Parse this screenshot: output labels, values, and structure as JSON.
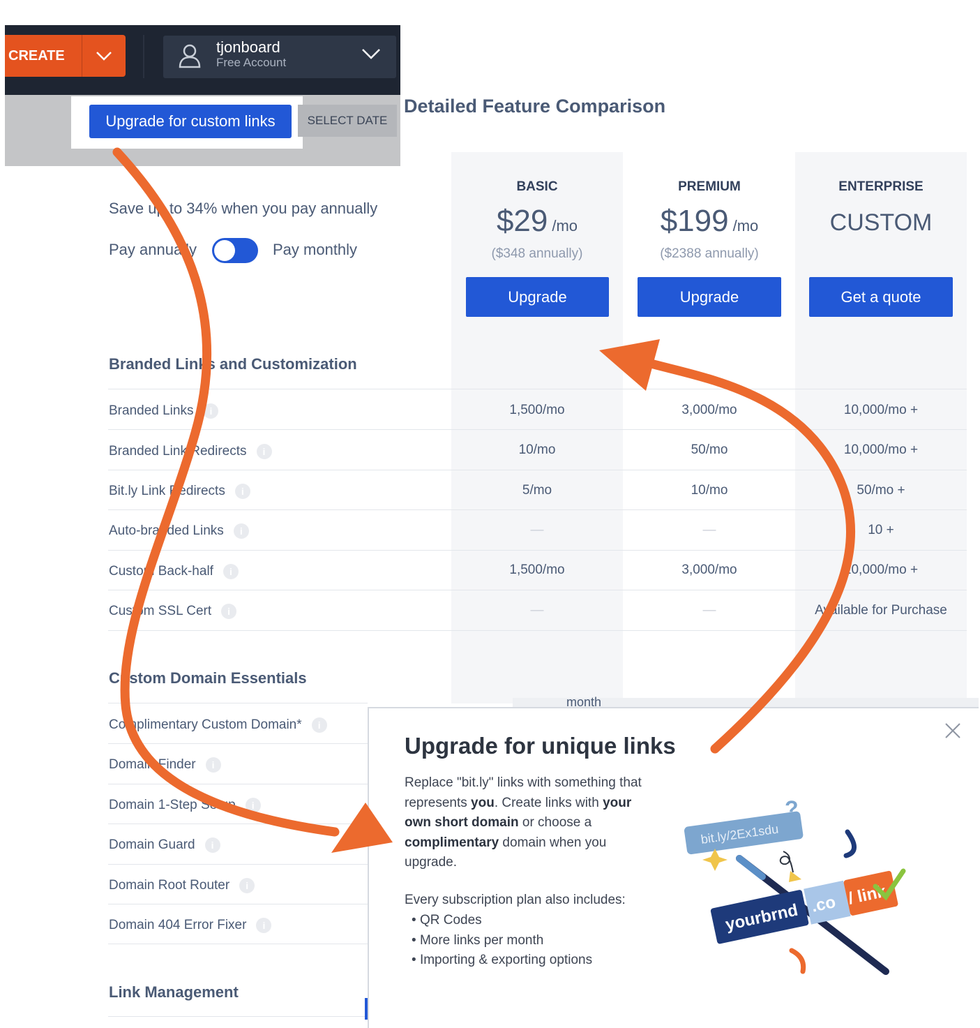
{
  "topbar": {
    "create_label": "CREATE",
    "username": "tjonboard",
    "account_type": "Free Account",
    "upgrade_custom_label": "Upgrade for custom links",
    "select_date_label": "SELECT DATE"
  },
  "comparison": {
    "title": "Detailed Feature Comparison",
    "save_text": "Save up to 34% when you pay annually",
    "pay_annually": "Pay annually",
    "pay_monthly": "Pay monthly",
    "plans": [
      {
        "name": "BASIC",
        "price": "$29",
        "unit": "/mo",
        "annual": "($348 annually)",
        "button": "Upgrade"
      },
      {
        "name": "PREMIUM",
        "price": "$199",
        "unit": "/mo",
        "annual": "($2388 annually)",
        "button": "Upgrade"
      },
      {
        "name": "ENTERPRISE",
        "price": "CUSTOM",
        "unit": "",
        "annual": "",
        "button": "Get a quote"
      }
    ],
    "sections": [
      {
        "title": "Branded Links and Customization",
        "rows": [
          {
            "label": "Branded Links",
            "values": [
              "1,500/mo",
              "3,000/mo",
              "10,000/mo +"
            ]
          },
          {
            "label": "Branded Link Redirects",
            "values": [
              "10/mo",
              "50/mo",
              "10,000/mo +"
            ]
          },
          {
            "label": "Bit.ly Link Redirects",
            "values": [
              "5/mo",
              "10/mo",
              "50/mo +"
            ]
          },
          {
            "label": "Auto-branded Links",
            "values": [
              "—",
              "—",
              "10 +"
            ]
          },
          {
            "label": "Custom Back-half",
            "values": [
              "1,500/mo",
              "3,000/mo",
              "10,000/mo +"
            ]
          },
          {
            "label": "Custom SSL Cert",
            "values": [
              "—",
              "—",
              "Available for Purchase"
            ]
          }
        ]
      },
      {
        "title": "Custom Domain Essentials",
        "rows": [
          {
            "label": "Complimentary Custom Domain*"
          },
          {
            "label": "Domain Finder"
          },
          {
            "label": "Domain 1-Step Setup"
          },
          {
            "label": "Domain Guard"
          },
          {
            "label": "Domain Root Router"
          },
          {
            "label": "Domain 404 Error Fixer"
          }
        ]
      },
      {
        "title": "Link Management"
      }
    ],
    "peek_text": "month"
  },
  "modal": {
    "title": "Upgrade for unique links",
    "body_1": "Replace \"bit.ly\" links with something that represents ",
    "body_you": "you",
    "body_2": ". Create links with ",
    "body_domain": "your own short domain",
    "body_3": " or choose a ",
    "body_compl": "complimentary",
    "body_4": " domain when you upgrade.",
    "includes_heading": "Every subscription plan also includes:",
    "includes": [
      "QR Codes",
      "More links per month",
      "Importing & exporting options"
    ],
    "illustration": {
      "old_link": "bit.ly/2Ex1sdu",
      "brand": "yourbrnd",
      "tld": ".co",
      "path": "/ link"
    }
  },
  "colors": {
    "accent_blue": "#2258d6",
    "arrow_orange": "#ec6a2e",
    "create_orange": "#e4531f",
    "nav_dark": "#1e2532"
  }
}
